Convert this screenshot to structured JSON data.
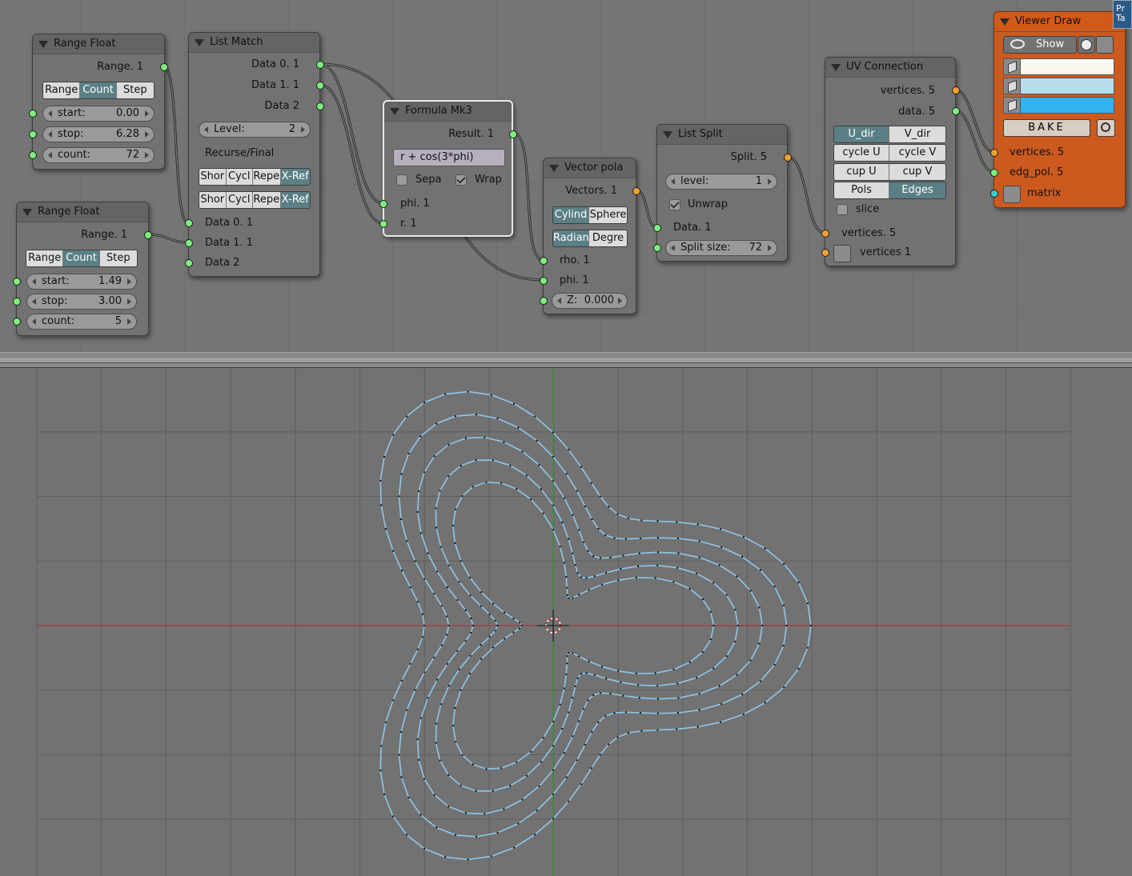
{
  "node_editor": {
    "range_float_1": {
      "title": "Range Float",
      "output": "Range. 1",
      "modes": [
        "Range",
        "Count",
        "Step"
      ],
      "active_mode": "Count",
      "start_label": "start:",
      "start_value": "0.00",
      "stop_label": "stop:",
      "stop_value": "6.28",
      "count_label": "count:",
      "count_value": "72"
    },
    "range_float_2": {
      "title": "Range Float",
      "output": "Range. 1",
      "modes": [
        "Range",
        "Count",
        "Step"
      ],
      "active_mode": "Count",
      "start_label": "start:",
      "start_value": "1.49",
      "stop_label": "stop:",
      "stop_value": "3.00",
      "count_label": "count:",
      "count_value": "5"
    },
    "list_match": {
      "title": "List Match",
      "outputs": [
        "Data 0. 1",
        "Data 1. 1",
        "Data 2"
      ],
      "level_label": "Level:",
      "level_value": "2",
      "recurse_label": "Recurse/Final",
      "row1": [
        "Shor",
        "Cycl",
        "Repe",
        "X-Ref"
      ],
      "row2": [
        "Shor",
        "Cycl",
        "Repe",
        "X-Ref"
      ],
      "inputs": [
        "Data 0. 1",
        "Data 1. 1",
        "Data 2"
      ]
    },
    "formula": {
      "title": "Formula Mk3",
      "output": "Result. 1",
      "expression": "r + cos(3*phi)",
      "sepa_label": "Sepa",
      "sepa_checked": false,
      "wrap_label": "Wrap",
      "wrap_checked": true,
      "inputs": [
        "phi. 1",
        "r. 1"
      ]
    },
    "vector_polar": {
      "title": "Vector pola",
      "output": "Vectors. 1",
      "coord_modes": [
        "Cylind",
        "Sphere"
      ],
      "angle_modes": [
        "Radian",
        "Degre"
      ],
      "inputs": [
        "rho. 1",
        "phi. 1"
      ],
      "z_label": "Z:",
      "z_value": "0.000"
    },
    "list_split": {
      "title": "List Split",
      "output": "Split. 5",
      "level_label": "level:",
      "level_value": "1",
      "unwrap_label": "Unwrap",
      "unwrap_checked": true,
      "input": "Data. 1",
      "split_label": "Split size:",
      "split_value": "72"
    },
    "uv_connection": {
      "title": "UV Connection",
      "outputs": [
        "vertices. 5",
        "data. 5"
      ],
      "dir": [
        "U_dir",
        "V_dir"
      ],
      "cycle": [
        "cycle U",
        "cycle V"
      ],
      "cup": [
        "cup U",
        "cup V"
      ],
      "type": [
        "Pols",
        "Edges"
      ],
      "slice_label": "slice",
      "inputs": [
        "vertices. 5",
        "vertices 1"
      ]
    },
    "viewer_draw": {
      "title": "Viewer Draw",
      "show_label": "Show",
      "bake_label": "BAKE",
      "colors": [
        "#fbf8ef",
        "#b7ddef",
        "#33b2ee"
      ],
      "inputs": [
        "vertices. 5",
        "edg_pol. 5",
        "matrix"
      ]
    },
    "side_tab": "Pr Ta"
  },
  "viewport": {
    "formula": "r + cos(3*phi)",
    "radii": [
      1.49,
      1.8675,
      2.245,
      2.6225,
      3.0
    ],
    "points_per_curve": 72,
    "curve_color": "#8fc7ea",
    "x_axis_color": "#b03030",
    "y_axis_color": "#2f9a2f"
  }
}
